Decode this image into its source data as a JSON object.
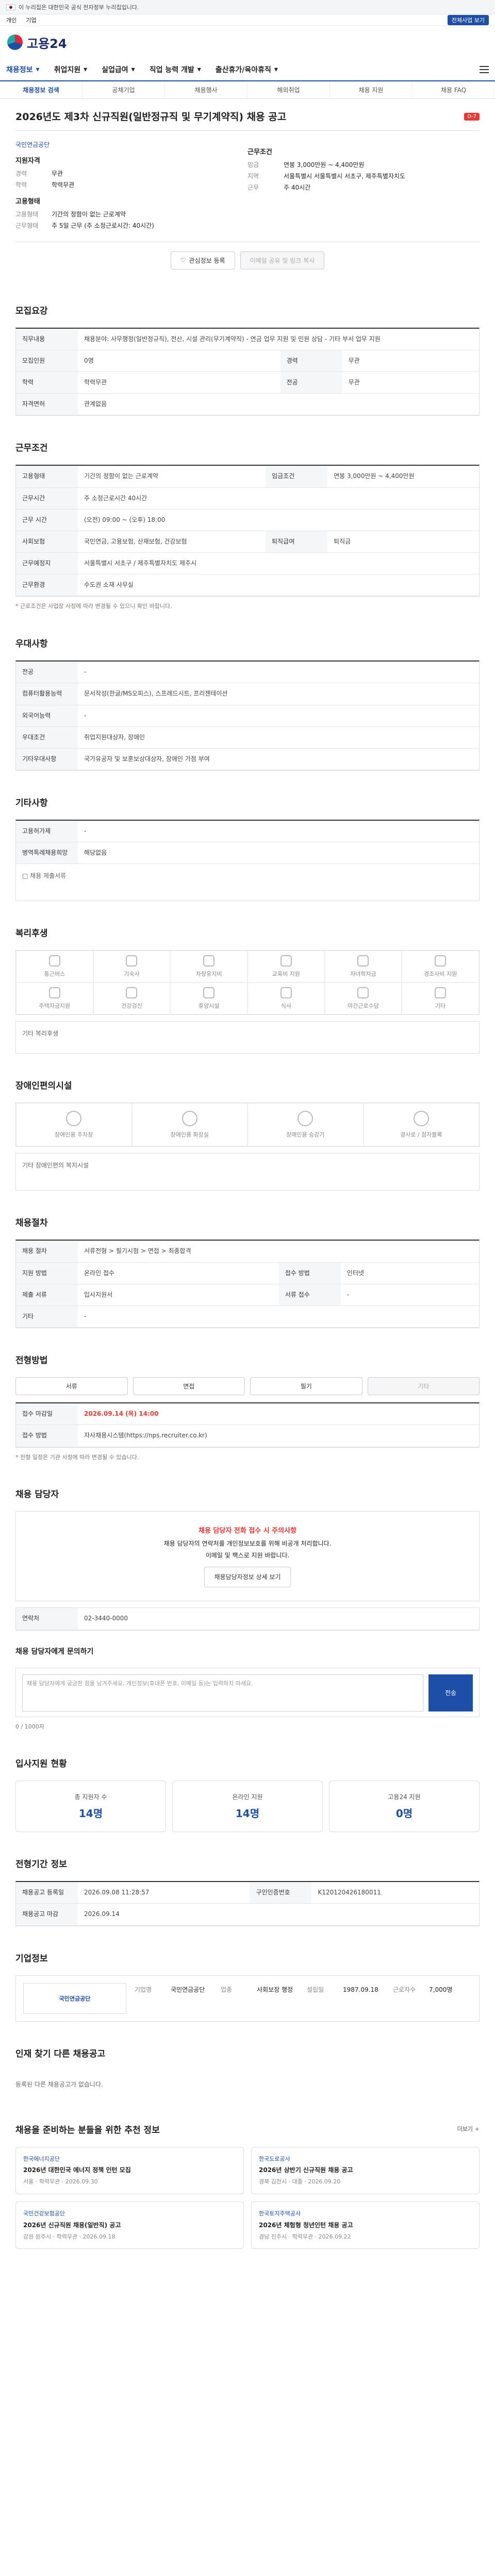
{
  "topbar": {
    "notice": "이 누리집은 대한민국 공식 전자정부 누리집입니다."
  },
  "subbar": {
    "links": [
      "개인",
      "기업"
    ],
    "chip": "전체사업 보기"
  },
  "header": {
    "logo_text": "고용24"
  },
  "gnb": {
    "items": [
      "채용정보",
      "취업지원",
      "실업급여",
      "직업 능력 개발",
      "출산휴가/육아휴직"
    ]
  },
  "subnav": [
    "채용정보 검색",
    "공채기업",
    "채용행사",
    "해외취업",
    "채용 지원",
    "채용 FAQ"
  ],
  "job": {
    "title": "2026년도 제3차 신규직원(일반정규직 및 무기계약직) 채용 공고",
    "badge": "D-7",
    "company_label": "국민연금공단",
    "summary_left_title": "지원자격",
    "summary_left": [
      {
        "k": "경력",
        "v": "무관"
      },
      {
        "k": "학력",
        "v": "학력무관"
      }
    ],
    "summary_left2_title": "고용형태",
    "summary_left2": [
      {
        "k": "고용형태",
        "v": "기간의 정함이 없는 근로계약"
      },
      {
        "k": "근무형태",
        "v": "주 5일 근무 (주 소정근로시간: 40시간)"
      }
    ],
    "summary_right_title": "근무조건",
    "summary_right": [
      {
        "k": "임금",
        "v": "연봉 3,000만원 ~ 4,400만원"
      },
      {
        "k": "지역",
        "v": "서울특별시 서울특별시 서초구, 제주특별자치도"
      },
      {
        "k": "근무",
        "v": "주 40시간"
      }
    ]
  },
  "buttons": {
    "scrap": "관심정보 등록",
    "share": "이메일 공유 및 링크 복사"
  },
  "sections": {
    "req": "모집요강",
    "work": "근무조건",
    "welfare": "우대사항",
    "other": "기타사항",
    "welfare2": "복리후생",
    "disabled": "장애인편의시설",
    "process": "채용절차",
    "apply": "전형방법",
    "contact": "채용 담당자",
    "inquiry": "채용 담당자에게 문의하기",
    "stats": "입사지원 현황",
    "docs": "전형기간 정보",
    "company": "기업정보",
    "recent": "인재 찾기 다른 채용공고",
    "recommend": "채용을 준비하는 분들을 위한 추천 정보"
  },
  "req_table": [
    {
      "k": "직무내용",
      "v": "채용분야: 사무행정(일반정규직), 전산, 시설 관리(무기계약직) - 연금 업무 지원 및 민원 상담 - 기타 부서 업무 지원"
    },
    {
      "k": "모집인원",
      "v": "0명"
    },
    {
      "k": "경력",
      "v": "무관"
    },
    {
      "k": "학력",
      "v": "학력무관"
    },
    {
      "k": "전공",
      "v": "무관"
    },
    {
      "k": "자격면허",
      "v": "관계없음"
    }
  ],
  "work_table": [
    {
      "k": "고용형태",
      "v": "기간의 정함이 없는 근로계약"
    },
    {
      "k": "임금조건",
      "v": "연봉 3,000만원 ~ 4,400만원"
    },
    {
      "k": "근무시간",
      "v": "주 소정근로시간 40시간"
    },
    {
      "k": "근무 시간",
      "v": "(오전) 09:00 ~ (오후) 18:00"
    },
    {
      "k": "사회보험",
      "v": "국민연금, 고용보험, 산재보험, 건강보험"
    },
    {
      "k": "퇴직급여",
      "v": "퇴직금"
    },
    {
      "k": "근무예정지",
      "v": "서울특별시 서초구 / 제주특별자치도 제주시"
    },
    {
      "k": "근무환경",
      "v": "수도권 소재 사무실"
    }
  ],
  "work_note": "* 근로조건은 사업장 사정에 따라 변경될 수 있으니 확인 바랍니다.",
  "welfare_table": [
    {
      "k": "전공",
      "v": "-"
    },
    {
      "k": "컴퓨터활용능력",
      "v": "문서작성(한글/MS오피스), 스프레드시트, 프리젠테이션"
    },
    {
      "k": "외국어능력",
      "v": "-"
    },
    {
      "k": "우대조건",
      "v": "취업지원대상자, 장애인"
    },
    {
      "k": "기타우대사항",
      "v": "국가유공자 및 보훈보상대상자, 장애인 가점 부여"
    }
  ],
  "other_table": [
    {
      "k": "고용허가제",
      "v": "-"
    },
    {
      "k": "병역특례채용희망",
      "v": "해당없음"
    }
  ],
  "other_note": "□ 채용 제출서류",
  "welfare_icons": [
    "통근버스",
    "기숙사",
    "차량유지비",
    "교육비 지원",
    "자녀학자금",
    "경조사비 지원",
    "주택자금지원",
    "건강검진",
    "휴양시설",
    "식사",
    "야간근로수당",
    "기타"
  ],
  "welfare_etc": "기타 복리후생",
  "disabled_icons": [
    "장애인용 주차장",
    "장애인용 화장실",
    "장애인용 승강기",
    "경사로 / 점자블록"
  ],
  "disabled_etc": "기타 장애인편의 복지시설",
  "process_table": [
    {
      "k": "채용 절차",
      "v": "서류전형 > 필기시험 > 면접 > 최종합격"
    },
    {
      "k": "지원 방법",
      "v": "온라인 접수"
    },
    {
      "k": "접수 방법",
      "v": "인터넷"
    },
    {
      "k": "제출 서류",
      "v": "입사지원서"
    },
    {
      "k": "서류 접수",
      "v": "-"
    },
    {
      "k": "기타",
      "v": "-"
    }
  ],
  "apply_buttons": [
    "서류",
    "면접",
    "필기",
    "기타"
  ],
  "apply_period_label": "접수 마감일",
  "apply_period": "2026.09.14 (목) 14:00",
  "apply_method_label": "접수 방법",
  "apply_method": "자사채용시스템(https://nps.recruiter.co.kr)",
  "apply_note": "* 전형 일정은 기관 사정에 따라 변경될 수 있습니다.",
  "contact": {
    "warn": "채용 담당자 전화 접수 시 주의사항",
    "line1": "채용 담당자의 연락처를 개인정보보호를 위해 비공개 처리합니다.",
    "line2": "이메일 및 팩스로 지원 바랍니다.",
    "btn": "채용담당자정보 상세 보기",
    "phone_label": "연락처",
    "phone": "02-3440-0000"
  },
  "inquiry": {
    "placeholder": "채용 담당자에게 궁금한 점을 남겨주세요. 개인정보(휴대폰 번호, 이메일 등)는 입력하지 마세요.",
    "count": "0 / 1000자",
    "send": "전송"
  },
  "stats": [
    {
      "label": "총 지원자 수",
      "value": "14명"
    },
    {
      "label": "온라인 지원",
      "value": "14명"
    },
    {
      "label": "고용24 지원",
      "value": "0명"
    }
  ],
  "docs_table": [
    {
      "k": "채용공고 등록일",
      "v": "2026.09.08 11:28:57"
    },
    {
      "k": "채용공고 마감",
      "v": "2026.09.14"
    },
    {
      "k": "구인인증번호",
      "v": "K120120426180011"
    }
  ],
  "company": {
    "name": "국민연금공단",
    "fields": [
      {
        "k": "기업명",
        "v": "국민연금공단"
      },
      {
        "k": "업종",
        "v": "사회보장 행정"
      },
      {
        "k": "설립일",
        "v": "1987.09.18"
      },
      {
        "k": "근로자수",
        "v": "7,000명"
      }
    ]
  },
  "recent_empty": "등록된 다른 채용공고가 없습니다.",
  "cards": [
    {
      "co": "한국에너지공단",
      "title": "2026년 대한민국 에너지 정책 인턴 모집",
      "meta": "서울 · 학력무관 · 2026.09.30"
    },
    {
      "co": "한국도로공사",
      "title": "2026년 상반기 신규직원 채용 공고",
      "meta": "경북 김천시 · 대졸 · 2026.09.20"
    },
    {
      "co": "국민건강보험공단",
      "title": "2026년 신규직원 채용(일반직) 공고",
      "meta": "강원 원주시 · 학력무관 · 2026.09.18"
    },
    {
      "co": "한국토지주택공사",
      "title": "2026년 체험형 청년인턴 채용 공고",
      "meta": "경남 진주시 · 학력무관 · 2026.09.22"
    }
  ],
  "more_label": "더보기 +"
}
